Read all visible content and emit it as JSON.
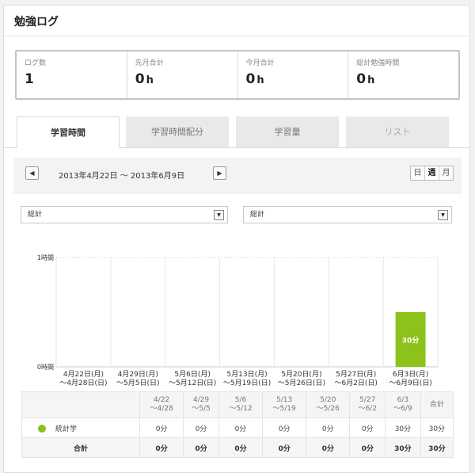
{
  "title": "勉強ログ",
  "stats": [
    {
      "label": "ログ数",
      "value": "1",
      "unit": ""
    },
    {
      "label": "先月合計",
      "value": "0",
      "unit": "h"
    },
    {
      "label": "今月合計",
      "value": "0",
      "unit": "h"
    },
    {
      "label": "総計勉強時間",
      "value": "0",
      "unit": "h"
    }
  ],
  "tabs": [
    "学習時間",
    "学習時間配分",
    "学習量",
    "リスト"
  ],
  "date_range": "2013年4月22日 ～ 2013年6月9日",
  "prev_icon": "◀",
  "next_icon": "▶",
  "period": [
    "日",
    "週",
    "月"
  ],
  "selects": [
    {
      "value": "総計"
    },
    {
      "value": "総計"
    }
  ],
  "colors": {
    "accent": "#8cc21a"
  },
  "chart_data": {
    "type": "bar",
    "categories": [
      [
        "4月22日(月)",
        "～4月28日(日)"
      ],
      [
        "4月29日(月)",
        "～5月5日(日)"
      ],
      [
        "5月6日(月)",
        "～5月12日(日)"
      ],
      [
        "5月13日(月)",
        "～5月19日(日)"
      ],
      [
        "5月20日(月)",
        "～5月26日(日)"
      ],
      [
        "5月27日(月)",
        "～6月2日(日)"
      ],
      [
        "6月3日(月)",
        "～6月9日(日)"
      ]
    ],
    "values": [
      0,
      0,
      0,
      0,
      0,
      0,
      30
    ],
    "data_labels": [
      "",
      "",
      "",
      "",
      "",
      "",
      "30分"
    ],
    "y_ticks": [
      {
        "v": 0,
        "label": "0時間"
      },
      {
        "v": 60,
        "label": "1時間"
      }
    ],
    "ylim": [
      0,
      60
    ],
    "series_color": "#8cc21a",
    "grid": true
  },
  "table": {
    "header": [
      [
        "4/22",
        "～4/28"
      ],
      [
        "4/29",
        "～5/5"
      ],
      [
        "5/6",
        "～5/12"
      ],
      [
        "5/13",
        "～5/19"
      ],
      [
        "5/20",
        "～5/26"
      ],
      [
        "5/27",
        "～6/2"
      ],
      [
        "6/3",
        "～6/9"
      ],
      [
        "合計"
      ]
    ],
    "rows": [
      {
        "name": "統計学",
        "color": "#8cc21a",
        "cells": [
          "0分",
          "0分",
          "0分",
          "0分",
          "0分",
          "0分",
          "30分",
          "30分"
        ]
      }
    ],
    "total": {
      "name": "合計",
      "cells": [
        "0分",
        "0分",
        "0分",
        "0分",
        "0分",
        "0分",
        "30分",
        "30分"
      ]
    }
  }
}
